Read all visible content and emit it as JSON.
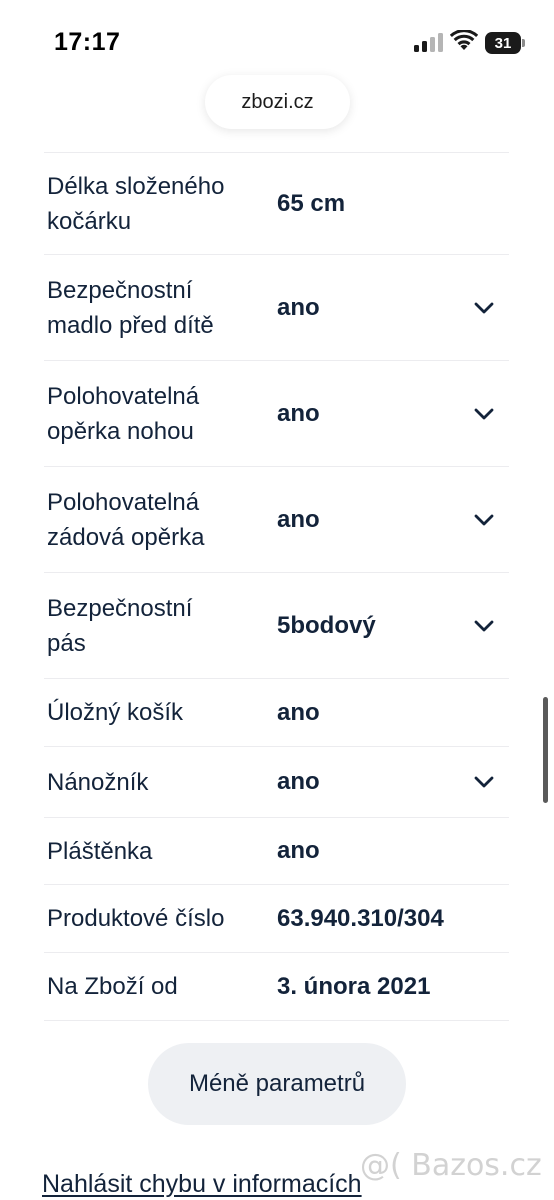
{
  "status_bar": {
    "time": "17:17",
    "battery": "31"
  },
  "browser": {
    "url": "zbozi.cz"
  },
  "params": [
    {
      "label_lines": [
        "Délka složeného",
        "kočárku"
      ],
      "value": "65 cm",
      "expandable": false
    },
    {
      "label_lines": [
        "Bezpečnostní",
        "madlo před dítě"
      ],
      "value": "ano",
      "expandable": true
    },
    {
      "label_lines": [
        "Polohovatelná",
        "opěrka nohou"
      ],
      "value": "ano",
      "expandable": true
    },
    {
      "label_lines": [
        "Polohovatelná",
        "zádová opěrka"
      ],
      "value": "ano",
      "expandable": true
    },
    {
      "label_lines": [
        "Bezpečnostní",
        "pás"
      ],
      "value": "5bodový",
      "expandable": true
    },
    {
      "label_lines": [
        "Úložný košík"
      ],
      "value": "ano",
      "expandable": false
    },
    {
      "label_lines": [
        "Nánožník"
      ],
      "value": "ano",
      "expandable": true
    },
    {
      "label_lines": [
        "Pláštěnka"
      ],
      "value": "ano",
      "expandable": false
    },
    {
      "label_lines": [
        "Produktové číslo"
      ],
      "value": "63.940.310/304",
      "expandable": false
    },
    {
      "label_lines": [
        "Na Zboží od"
      ],
      "value": "3. února 2021",
      "expandable": false
    }
  ],
  "less_button": {
    "label": "Méně parametrů"
  },
  "report_link": {
    "label": "Nahlásit chybu v informacích"
  },
  "watermark": {
    "text": "@( Bazos.cz"
  },
  "colors": {
    "text": "#13233a",
    "divider": "#ececef",
    "button_bg": "#eef0f3"
  }
}
